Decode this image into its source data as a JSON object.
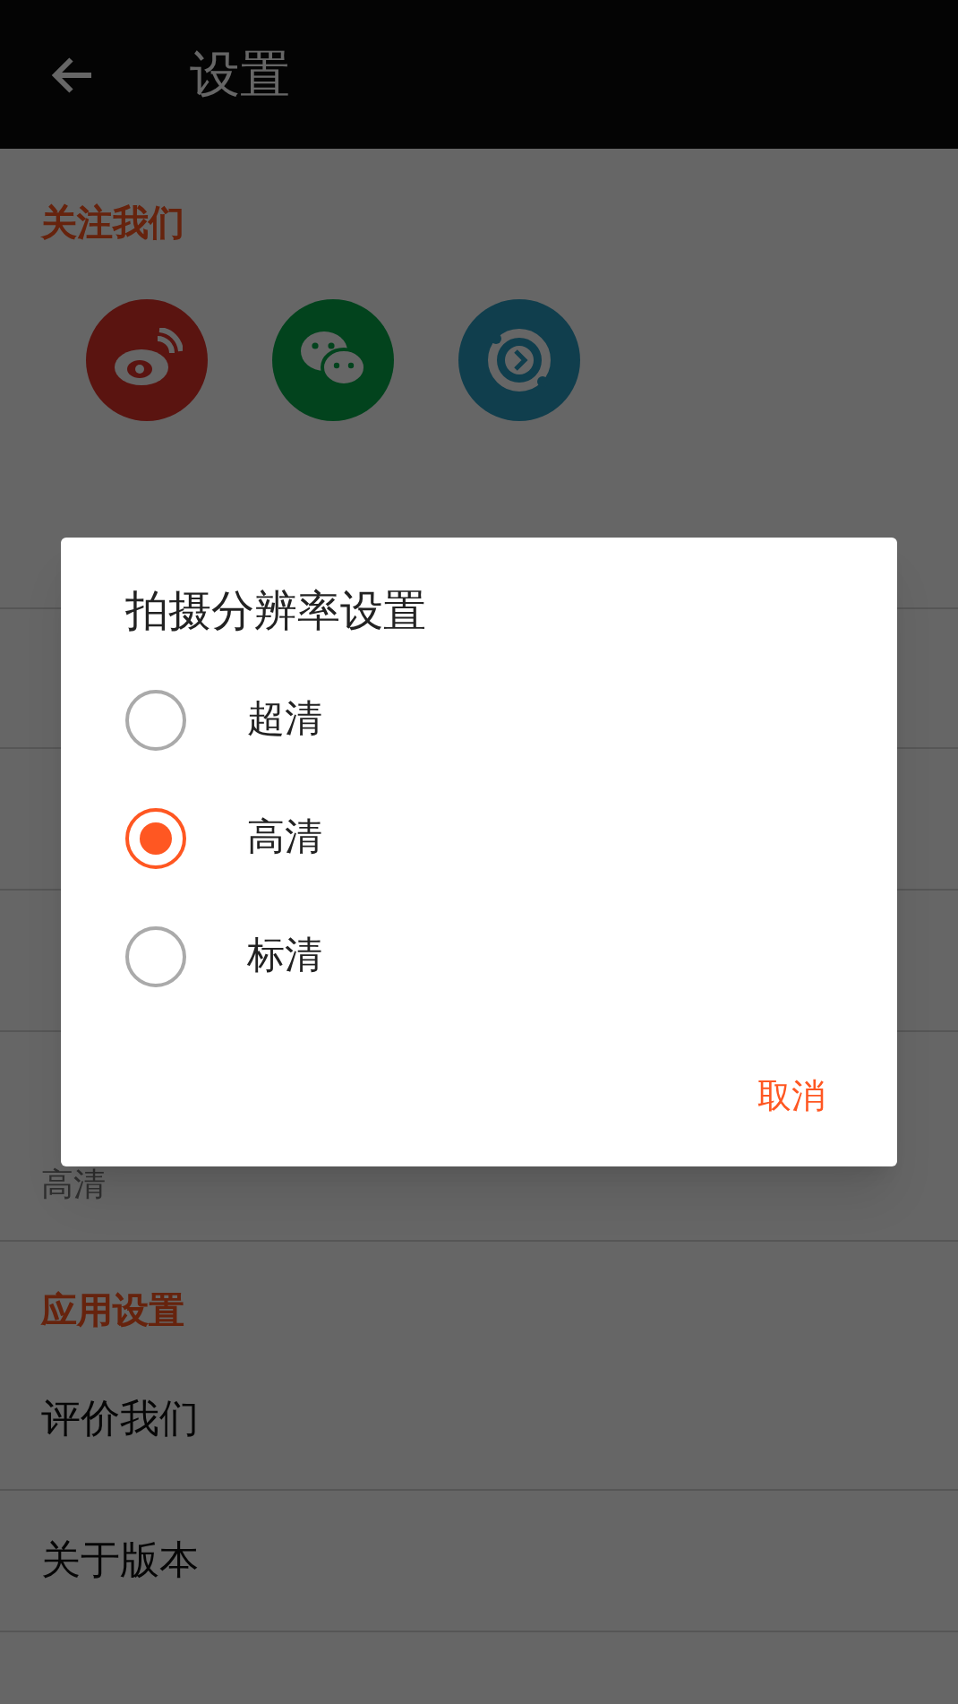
{
  "app_bar": {
    "title": "设置"
  },
  "follow": {
    "title": "关注我们"
  },
  "current_resolution": {
    "value": "高清"
  },
  "app_settings": {
    "title": "应用设置",
    "rows": [
      {
        "label": "评价我们"
      },
      {
        "label": "关于版本"
      }
    ]
  },
  "dialog": {
    "title": "拍摄分辨率设置",
    "options": [
      {
        "label": "超清",
        "selected": false
      },
      {
        "label": "高清",
        "selected": true
      },
      {
        "label": "标清",
        "selected": false
      }
    ],
    "cancel": "取消"
  }
}
